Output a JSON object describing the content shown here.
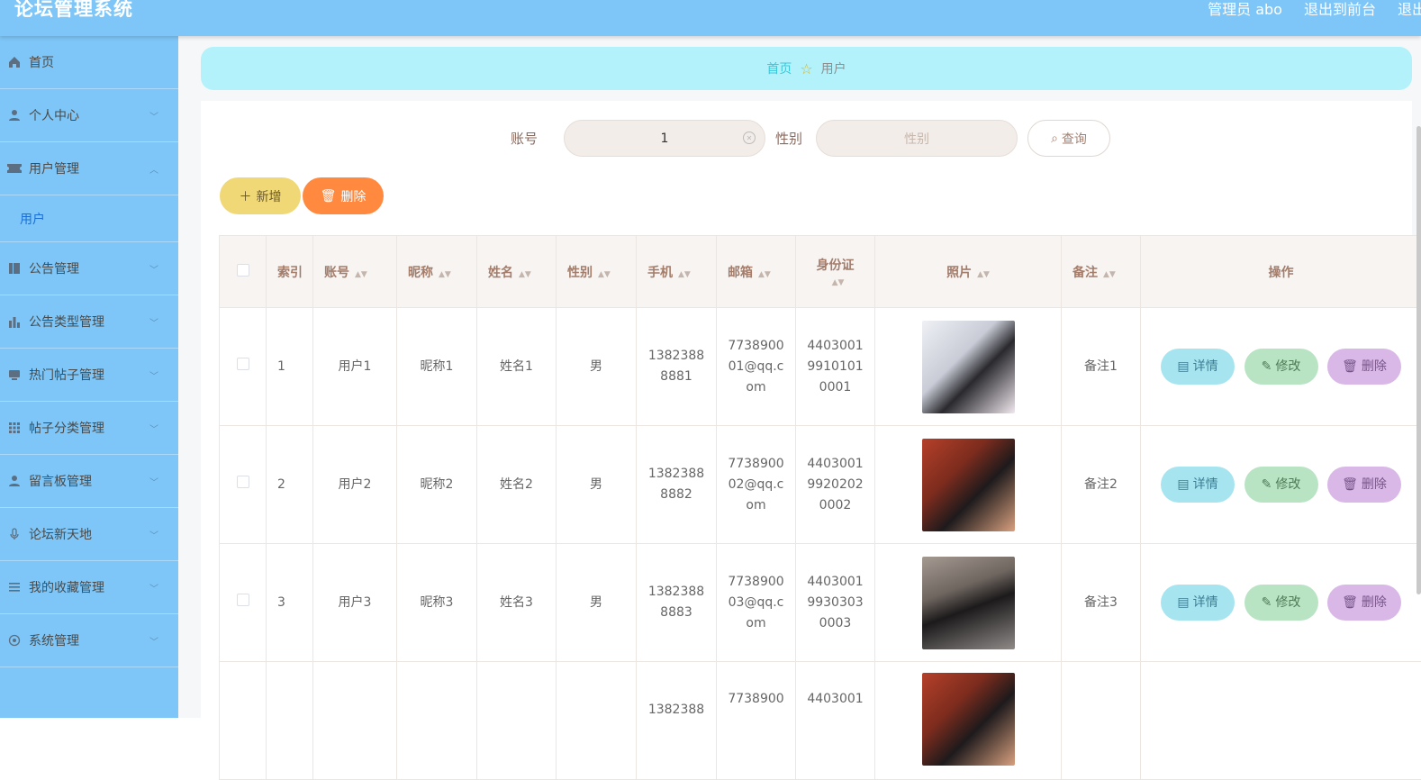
{
  "header": {
    "title": "论坛管理系统",
    "admin": "管理员 abo",
    "to_front": "退出到前台",
    "logout": "退出"
  },
  "sidebar": {
    "items": [
      {
        "label": "首页",
        "icon": "home-icon"
      },
      {
        "label": "个人中心",
        "icon": "user-icon"
      },
      {
        "label": "用户管理",
        "icon": "ticket-icon"
      },
      {
        "label": "用户",
        "sub": true
      },
      {
        "label": "公告管理",
        "icon": "book-icon"
      },
      {
        "label": "公告类型管理",
        "icon": "bar-chart-icon"
      },
      {
        "label": "热门帖子管理",
        "icon": "monitor-icon"
      },
      {
        "label": "帖子分类管理",
        "icon": "grid-icon"
      },
      {
        "label": "留言板管理",
        "icon": "person-icon"
      },
      {
        "label": "论坛新天地",
        "icon": "mic-icon"
      },
      {
        "label": "我的收藏管理",
        "icon": "list-icon"
      },
      {
        "label": "系统管理",
        "icon": "settings-icon"
      }
    ]
  },
  "breadcrumb": {
    "home": "首页",
    "current": "用户"
  },
  "search": {
    "account_label": "账号",
    "account_value": "1",
    "gender_label": "性别",
    "gender_placeholder": "性别",
    "query": "查询"
  },
  "actions": {
    "add": "新增",
    "delete": "删除"
  },
  "table": {
    "headers": [
      "索引",
      "账号",
      "昵称",
      "姓名",
      "性别",
      "手机",
      "邮箱",
      "身份证",
      "照片",
      "备注",
      "操作"
    ],
    "rows": [
      {
        "index": "1",
        "account": "用户1",
        "nickname": "昵称1",
        "name": "姓名1",
        "gender": "男",
        "phone": "13823888881",
        "email": "773890001@qq.com",
        "idcard": "440300199101010001",
        "note": "备注1"
      },
      {
        "index": "2",
        "account": "用户2",
        "nickname": "昵称2",
        "name": "姓名2",
        "gender": "男",
        "phone": "13823888882",
        "email": "773890002@qq.com",
        "idcard": "440300199202020002",
        "note": "备注2"
      },
      {
        "index": "3",
        "account": "用户3",
        "nickname": "昵称3",
        "name": "姓名3",
        "gender": "男",
        "phone": "13823888883",
        "email": "773890003@qq.com",
        "idcard": "440300199303030003",
        "note": "备注3"
      },
      {
        "index": "",
        "account": "",
        "nickname": "",
        "name": "",
        "gender": "",
        "phone": "1382388",
        "email": "7738900",
        "idcard": "4403001",
        "note": ""
      }
    ],
    "row_ops": {
      "detail": "详情",
      "edit": "修改",
      "delete": "删除"
    }
  }
}
